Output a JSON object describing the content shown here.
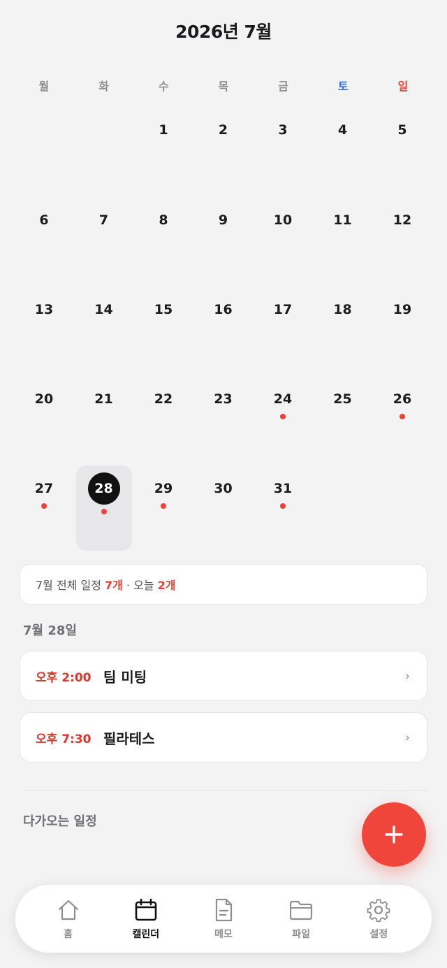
{
  "header": {
    "title": "2026년 7월"
  },
  "weekdays": [
    "월",
    "화",
    "수",
    "목",
    "금",
    "토",
    "일"
  ],
  "calendar": {
    "weeks": [
      [
        null,
        null,
        "1",
        "2",
        "3",
        "4",
        "5"
      ],
      [
        "6",
        "7",
        "8",
        "9",
        "10",
        "11",
        "12"
      ],
      [
        "13",
        "14",
        "15",
        "16",
        "17",
        "18",
        "19"
      ],
      [
        "20",
        "21",
        "22",
        "23",
        "24",
        "25",
        "26"
      ],
      [
        "27",
        "28",
        "29",
        "30",
        "31",
        null,
        null
      ]
    ],
    "selected_day": "28",
    "days_with_events": [
      "24",
      "26",
      "27",
      "28",
      "29",
      "31"
    ]
  },
  "summary": {
    "prefix": "7월 전체 일정 ",
    "month_count": "7개",
    "separator": " · 오늘 ",
    "today_count": "2개"
  },
  "selected_date_label": "7월 28일",
  "events": [
    {
      "time": "오후 2:00",
      "title": "팀 미팅"
    },
    {
      "time": "오후 7:30",
      "title": "필라테스"
    }
  ],
  "event_chevron": "›",
  "upcoming_label": "다가오는 일정",
  "nav": {
    "items": [
      {
        "label": "홈",
        "icon": "home-icon"
      },
      {
        "label": "캘린더",
        "icon": "calendar-icon",
        "active": true
      },
      {
        "label": "메모",
        "icon": "document-icon"
      },
      {
        "label": "파일",
        "icon": "folder-icon"
      },
      {
        "label": "설정",
        "icon": "gear-icon"
      }
    ]
  },
  "colors": {
    "accent": "#f0453a",
    "saturday": "#3b6fd6",
    "sunday": "#e04438",
    "background": "#f3f3f4"
  }
}
